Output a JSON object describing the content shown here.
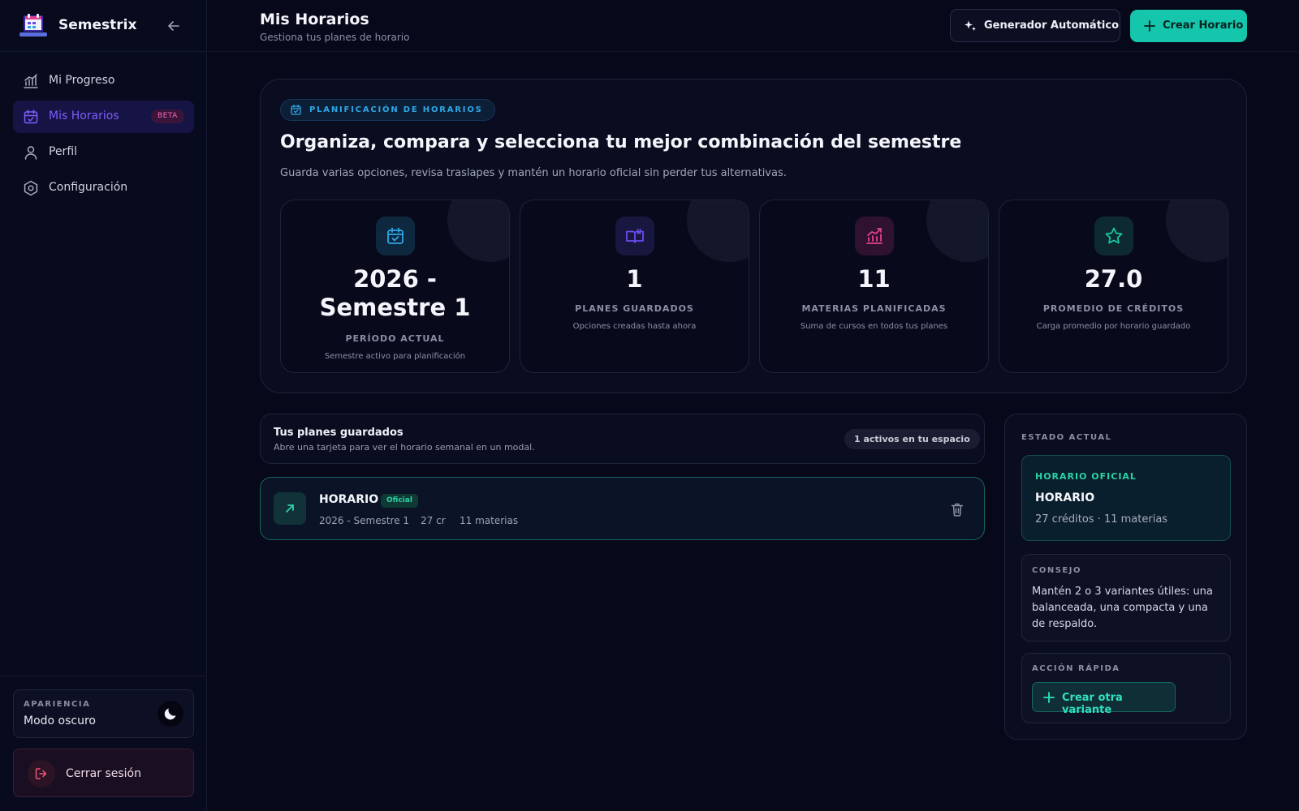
{
  "app": {
    "name": "Semestrix"
  },
  "sidebar": {
    "items": [
      {
        "label": "Mi Progreso",
        "icon": "chart-bars-icon"
      },
      {
        "label": "Mis Horarios",
        "icon": "calendar-check-icon",
        "badge": "BETA",
        "active": true
      },
      {
        "label": "Perfil",
        "icon": "user-icon"
      },
      {
        "label": "Configuración",
        "icon": "settings-hexagon-icon"
      }
    ],
    "appearance": {
      "caption": "APARIENCIA",
      "value": "Modo oscuro"
    },
    "logout_label": "Cerrar sesión"
  },
  "header": {
    "title": "Mis Horarios",
    "subtitle": "Gestiona tus planes de horario",
    "generator_label": "Generador Automático",
    "create_label": "Crear Horario"
  },
  "hero": {
    "pill": "PLANIFICACIÓN DE HORARIOS",
    "title": "Organiza, compara y selecciona tu mejor combinación del semestre",
    "subtitle": "Guarda varias opciones, revisa traslapes y mantén un horario oficial sin perder tus alternativas.",
    "stats": [
      {
        "value": "2026 - Semestre 1",
        "caption": "PERÍODO ACTUAL",
        "description": "Semestre activo para planificación",
        "icon": "calendar-check-icon",
        "color": "#2ea7e6"
      },
      {
        "value": "1",
        "caption": "PLANES GUARDADOS",
        "description": "Opciones creadas hasta ahora",
        "icon": "open-book-icon",
        "color": "#6a4cf0"
      },
      {
        "value": "11",
        "caption": "MATERIAS PLANIFICADAS",
        "description": "Suma de cursos en todos tus planes",
        "icon": "chart-up-icon",
        "color": "#e0418f"
      },
      {
        "value": "27.0",
        "caption": "PROMEDIO DE CRÉDITOS",
        "description": "Carga promedio por horario guardado",
        "icon": "star-icon",
        "color": "#19c7a4"
      }
    ]
  },
  "plans": {
    "title": "Tus planes guardados",
    "subtitle": "Abre una tarjeta para ver el horario semanal en un modal.",
    "active_badge": "1 activos en tu espacio",
    "items": [
      {
        "name": "HORARIO",
        "tag": "Oficial",
        "period": "2026 - Semestre 1",
        "credits": "27 cr",
        "subjects": "11 materias"
      }
    ]
  },
  "state": {
    "caption": "ESTADO ACTUAL",
    "official": {
      "caption": "HORARIO OFICIAL",
      "name": "HORARIO",
      "details": "27 créditos · 11 materias"
    },
    "tip": {
      "caption": "CONSEJO",
      "text": "Mantén 2 o 3 variantes útiles: una balanceada, una compacta y una de respaldo."
    },
    "quick": {
      "caption": "ACCIÓN RÁPIDA",
      "button": "Crear otra variante"
    }
  },
  "colors": {
    "accent": "#15c6ad",
    "violet": "#7d5cff",
    "background": "#07081a"
  }
}
